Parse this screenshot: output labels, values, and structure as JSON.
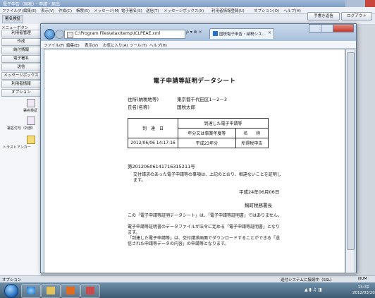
{
  "app": {
    "title": "電子申告（国税）・申請・届出",
    "menus": [
      "ファイル(F)",
      "編集(E)",
      "表示(V)",
      "作成(C)",
      "帳票(R)",
      "メッセージ(M)",
      "電子署名(S)",
      "送信(T)",
      "メッセージボックス(X)",
      "利用者情報登録(U)",
      "オプション(O)",
      "ヘルプ(H)"
    ],
    "toolbar_label": "署名検証",
    "buttons": {
      "save": "手書き返信",
      "logout": "ログアウト"
    },
    "left_header": "メニューボタン",
    "left_items": [
      "利用者管理",
      "作成",
      "納付情報",
      "電子署名",
      "送信",
      "メッセージボックス",
      "利用者情報",
      "オプション"
    ],
    "icons": [
      {
        "icon": "pen-certificate-icon",
        "label": "署名検証"
      },
      {
        "icon": "pen-certificate-icon",
        "label": "署名付与（外部）"
      },
      {
        "icon": "folder-icon",
        "label": "トラストアンカー"
      }
    ],
    "status_left": "オプション",
    "status_mid": "送付システムに接続中（SSL）",
    "status_right": "NUM"
  },
  "taskbar": {
    "time": "14:31",
    "date": "2012/03/20"
  },
  "ie": {
    "address": "C:\\Program Files\\etax\\temp\\ICLPEAE.xml",
    "address_controls": "ρ ▾ ⊗ ×",
    "tab_label": "国税電子申告・納税シス…",
    "menus": [
      "ファイル(F)",
      "編集(E)",
      "表示(V)",
      "お気に入り(A)",
      "ツール(T)",
      "ヘルプ(H)"
    ]
  },
  "doc": {
    "title": "電子申請等証明データシート",
    "address_label": "住所(納税地等)",
    "address_value": "東京都千代田区1－2－3",
    "name_label": "氏名(名称)",
    "name_value": "国税太郎",
    "table": {
      "col_arrival": "到　達　日",
      "col_doc": "到達した電子申請等",
      "col_year": "年分又は事業年度等",
      "col_name": "名　　称",
      "arrival_value": "2012/06/06 14:17:16",
      "year_value": "平成23年分",
      "name_value": "所得税申告"
    },
    "receipt_no": "第20120606141716315211号",
    "para1": "交付請求のあった電子申請等の事項は、上記のとおり、相違ないことを証明します。",
    "date": "平成24年06月06日",
    "office": "麹町税務署長",
    "note1": "この「電子申請等証明データシート」は、「電子申請等証明書」ではありません。",
    "note2": "電子申請等証明書のデータファイルが法令に定める「電子申請等証明書」となります。",
    "note3": "「到達した電子申請等」は、交付請求画面でダウンロードすることができる「送信された申請等データの内容」の申請等となります。"
  }
}
